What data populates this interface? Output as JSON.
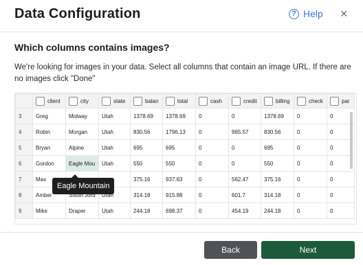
{
  "dialog": {
    "title": "Data Configuration",
    "help_label": "Help",
    "help_icon": "?",
    "close_icon": "×"
  },
  "question": "Which columns contains images?",
  "description": "We're looking for images in your data. Select all columns that contain an image URL. If there are no images click \"Done\"",
  "table": {
    "columns": [
      "client",
      "city",
      "state",
      "balan",
      "total",
      "cash",
      "credit",
      "billing",
      "check",
      "par"
    ],
    "rows": [
      {
        "num": "3",
        "cells": [
          "Greg",
          "Midway",
          "Utah",
          "1378.69",
          "1378.69",
          "0",
          "0",
          "1378.69",
          "0",
          "0"
        ]
      },
      {
        "num": "4",
        "cells": [
          "Robin",
          "Morgan",
          "Utah",
          "830.56",
          "1796.13",
          "0",
          "965.57",
          "830.56",
          "0",
          "0"
        ]
      },
      {
        "num": "5",
        "cells": [
          "Bryan",
          "Alpine",
          "Utah",
          "695",
          "695",
          "0",
          "0",
          "695",
          "0",
          "0"
        ]
      },
      {
        "num": "6",
        "cells": [
          "Gordon",
          "Eagle Mou",
          "Utah",
          "550",
          "550",
          "0",
          "0",
          "550",
          "0",
          "0"
        ]
      },
      {
        "num": "7",
        "cells": [
          "Max",
          "",
          "na",
          "375.16",
          "937.63",
          "0",
          "562.47",
          "375.16",
          "0",
          "0"
        ]
      },
      {
        "num": "8",
        "cells": [
          "Amber",
          "South Jord",
          "Utah",
          "314.18",
          "915.88",
          "0",
          "601.7",
          "314.18",
          "0",
          "0"
        ]
      },
      {
        "num": "9",
        "cells": [
          "Mike",
          "Draper",
          "Utah",
          "244.18",
          "698.37",
          "0",
          "454.19",
          "244.18",
          "0",
          "0"
        ]
      }
    ]
  },
  "tooltip": "Eagle Mountain",
  "buttons": {
    "back": "Back",
    "next": "Next"
  },
  "colors": {
    "help_blue": "#3a74d6",
    "next_green": "#1d5a3b",
    "back_gray": "#4f5257",
    "selected_cell": "#dcebe6"
  }
}
